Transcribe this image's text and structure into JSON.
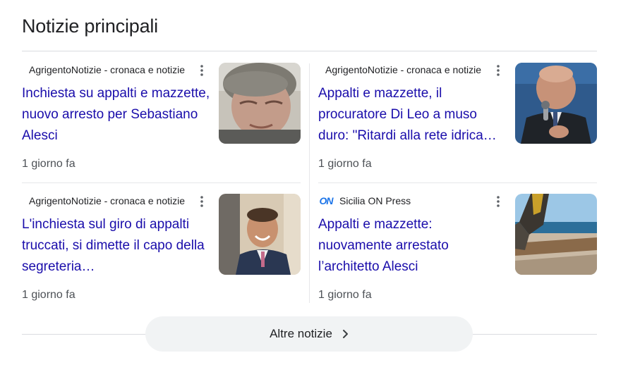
{
  "section": {
    "title": "Notizie principali"
  },
  "cards": [
    {
      "source": "AgrigentoNotizie - cronaca e notizie",
      "headline": "Inchiesta su appalti e mazzette, nuovo arresto per Sebastiano Alesci",
      "time": "1 giorno fa"
    },
    {
      "source": "AgrigentoNotizie - cronaca e notizie",
      "headline": "Appalti e mazzette, il procuratore Di Leo a muso duro: \"Ritardi alla rete idrica…",
      "time": "1 giorno fa"
    },
    {
      "source": "AgrigentoNotizie - cronaca e notizie",
      "headline": "L'inchiesta sul giro di appalti truccati, si dimette il capo della segreteria…",
      "time": "1 giorno fa"
    },
    {
      "source": "Sicilia ON Press",
      "source_logo_text": "ON",
      "headline": "Appalti e mazzette: nuovamente arrestato l’architetto Alesci",
      "time": "1 giorno fa"
    }
  ],
  "footer": {
    "more_label": "Altre notizie"
  },
  "colors": {
    "headline": "#1a0dab",
    "text": "#202124",
    "muted": "#4d5156",
    "divider": "#dadce0",
    "button_bg": "#f1f3f4",
    "sicilia_logo": "#1a73e8"
  },
  "icons": {
    "card_menu": "more-vert-icon",
    "more_arrow": "chevron-right-icon"
  }
}
